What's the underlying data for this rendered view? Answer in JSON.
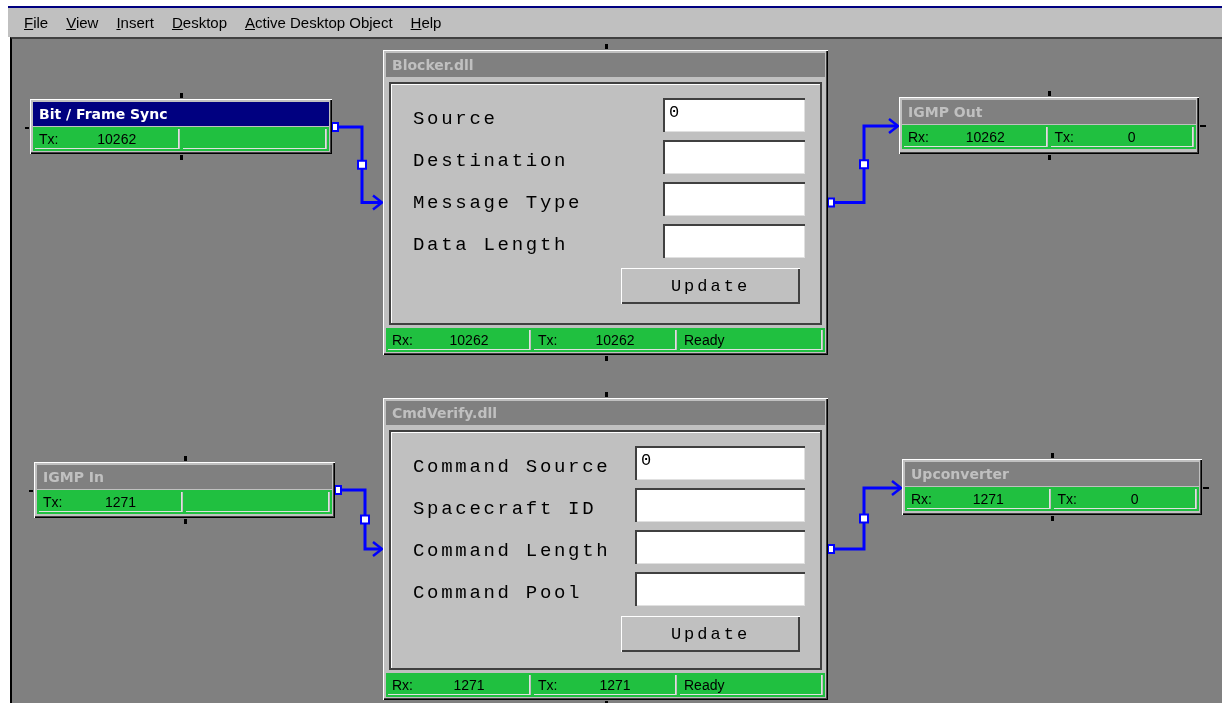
{
  "menu": [
    {
      "label": "File"
    },
    {
      "label": "View"
    },
    {
      "label": "Insert"
    },
    {
      "label": "Desktop"
    },
    {
      "label": "Active Desktop Object"
    },
    {
      "label": "Help"
    }
  ],
  "nodes": [
    {
      "kind": "module",
      "title": "Bit / Frame Sync",
      "selected": true,
      "status": [
        {
          "kind": "counter",
          "label": "Tx:",
          "value": "10262"
        },
        {
          "kind": "blank"
        }
      ]
    },
    {
      "kind": "dialog",
      "title": "Blocker.dll",
      "selected": false,
      "fields": [
        {
          "label": "Source",
          "value": "0"
        },
        {
          "label": "Destination"
        },
        {
          "label": "Message Type"
        },
        {
          "label": "Data Length"
        }
      ],
      "button": "Update",
      "status": [
        {
          "kind": "counter",
          "label": "Rx:",
          "value": "10262"
        },
        {
          "kind": "counter",
          "label": "Tx:",
          "value": "10262"
        },
        {
          "kind": "text",
          "text": "Ready"
        }
      ]
    },
    {
      "kind": "module",
      "title": "IGMP Out",
      "selected": false,
      "status": [
        {
          "kind": "counter",
          "label": "Rx:",
          "value": "10262"
        },
        {
          "kind": "counter",
          "label": "Tx:",
          "value": "0"
        }
      ]
    },
    {
      "kind": "module",
      "title": "IGMP In",
      "selected": false,
      "status": [
        {
          "kind": "counter",
          "label": "Tx:",
          "value": "1271"
        },
        {
          "kind": "blank"
        }
      ]
    },
    {
      "kind": "dialog",
      "title": "CmdVerify.dll",
      "selected": false,
      "fields": [
        {
          "label": "Command Source",
          "value": "0"
        },
        {
          "label": "Spacecraft ID"
        },
        {
          "label": "Command Length"
        },
        {
          "label": "Command Pool"
        }
      ],
      "button": "Update",
      "status": [
        {
          "kind": "counter",
          "label": "Rx:",
          "value": "1271"
        },
        {
          "kind": "counter",
          "label": "Tx:",
          "value": "1271"
        },
        {
          "kind": "text",
          "text": "Ready"
        }
      ]
    },
    {
      "kind": "module",
      "title": "Upconverter",
      "selected": false,
      "status": [
        {
          "kind": "counter",
          "label": "Rx:",
          "value": "1271"
        },
        {
          "kind": "counter",
          "label": "Tx:",
          "value": "0"
        }
      ]
    }
  ]
}
